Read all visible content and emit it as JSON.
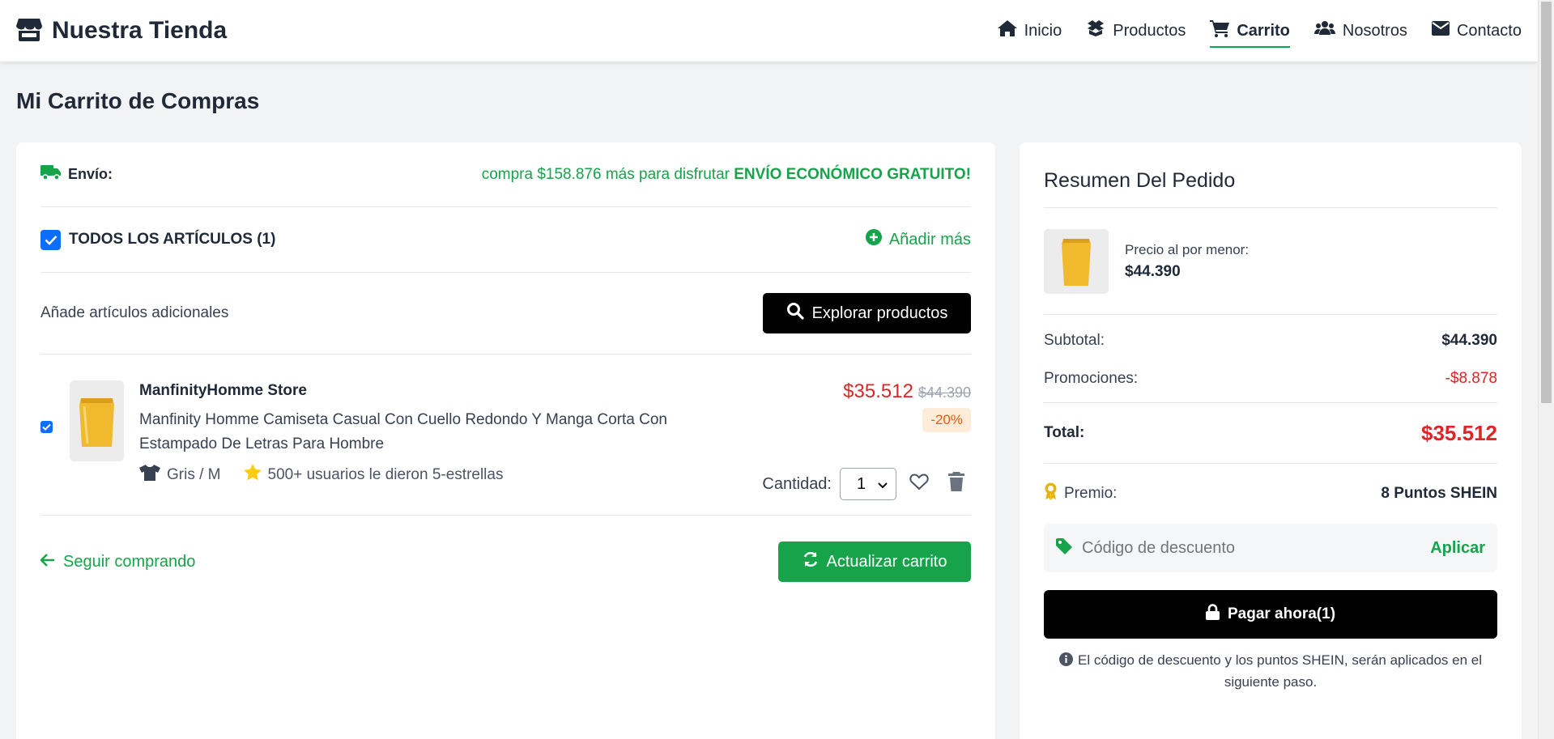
{
  "header": {
    "brand": "Nuestra Tienda",
    "nav": [
      {
        "label": "Inicio",
        "icon": "home-icon"
      },
      {
        "label": "Productos",
        "icon": "boxes-icon"
      },
      {
        "label": "Carrito",
        "icon": "cart-icon",
        "active": true
      },
      {
        "label": "Nosotros",
        "icon": "users-icon"
      },
      {
        "label": "Contacto",
        "icon": "envelope-icon"
      }
    ]
  },
  "page": {
    "title": "Mi Carrito de Compras"
  },
  "cart": {
    "shipping_label": "Envío:",
    "shipping_msg_prefix": "compra $158.876 más para disfrutar ",
    "shipping_msg_bold": "ENVÍO ECONÓMICO GRATUITO!",
    "all_items_label": "TODOS LOS ARTÍCULOS (1)",
    "add_more": "Añadir más",
    "extra_label": "Añade artículos adicionales",
    "explore_button": "Explorar productos",
    "item": {
      "store": "ManfinityHomme Store",
      "description": "Manfinity Homme Camiseta Casual Con Cuello Redondo Y Manga Corta Con Estampado De Letras Para Hombre",
      "variant": "Gris / M",
      "rating_text": "500+ usuarios le dieron 5-estrellas",
      "price": "$35.512",
      "old_price": "$44.390",
      "discount": "-20%",
      "qty_label": "Cantidad:",
      "qty": "1"
    },
    "continue_link": "Seguir comprando",
    "update_button": "Actualizar carrito"
  },
  "summary": {
    "title": "Resumen Del Pedido",
    "retail_label": "Precio al por menor:",
    "retail_value": "$44.390",
    "subtotal_label": "Subtotal:",
    "subtotal_value": "$44.390",
    "promo_label": "Promociones:",
    "promo_value": "-$8.878",
    "total_label": "Total:",
    "total_value": "$35.512",
    "reward_label": "Premio:",
    "reward_value": "8 Puntos SHEIN",
    "coupon_placeholder": "Código de descuento",
    "coupon_apply": "Aplicar",
    "pay_button": "Pagar ahora(1)",
    "note": "El código de descuento y los puntos SHEIN, serán aplicados en el siguiente paso."
  },
  "colors": {
    "accent_green": "#16a34a",
    "price_red": "#dc2626",
    "check_blue": "#0d6efd"
  }
}
